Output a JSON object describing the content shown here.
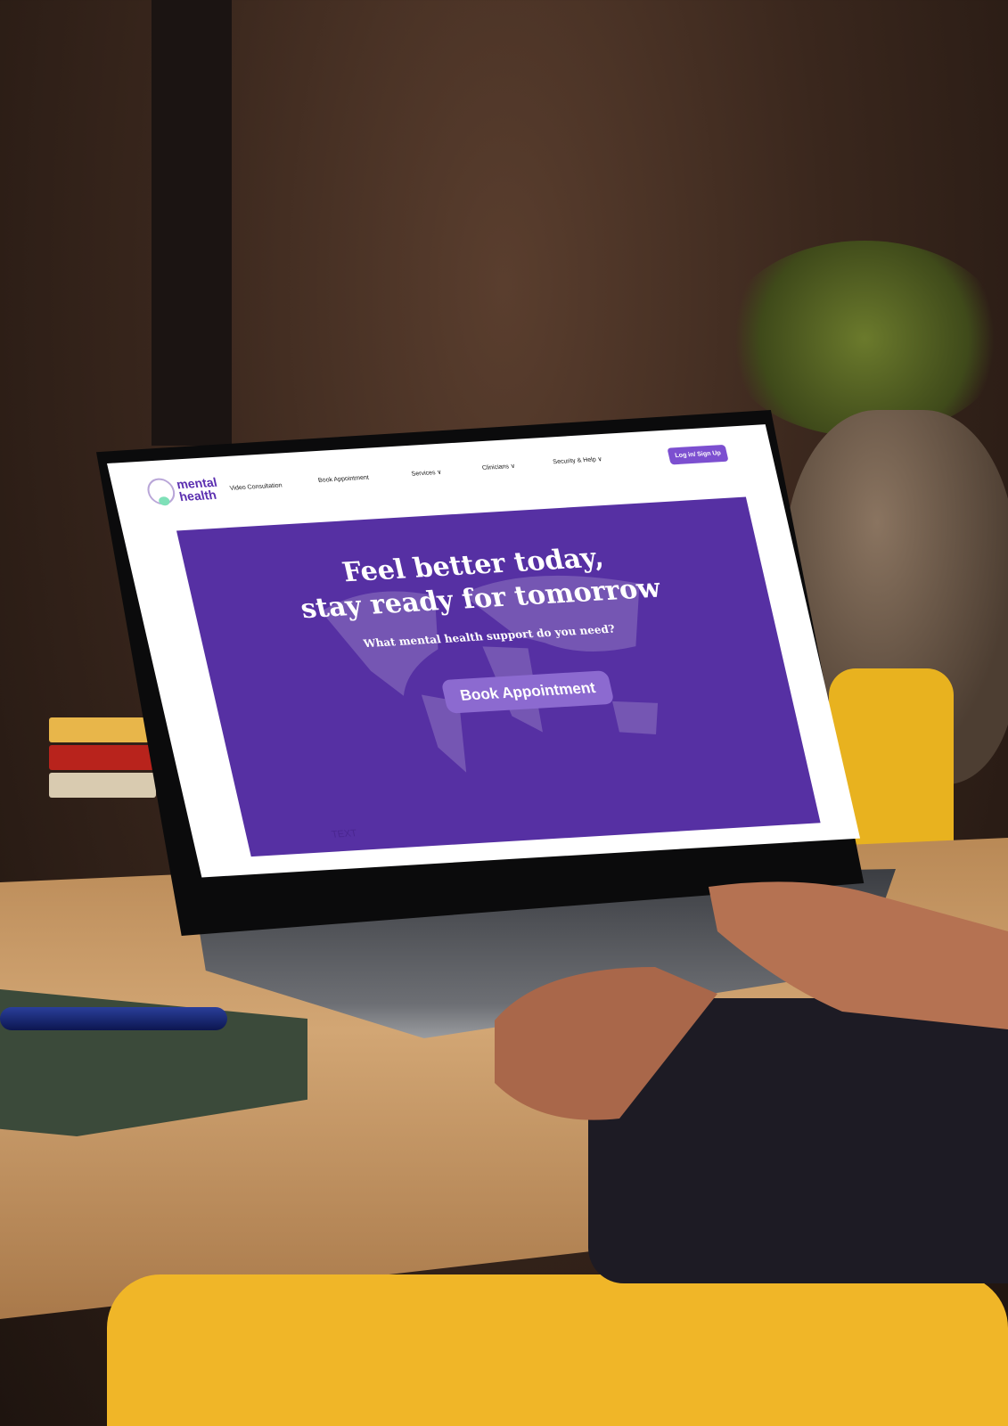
{
  "site": {
    "logo": {
      "line1": "mental",
      "line2": "health"
    },
    "nav": [
      {
        "label": "Video Consultation"
      },
      {
        "label": "Book Appointment"
      },
      {
        "label": "Services",
        "dropdown": "chevron-down-icon"
      },
      {
        "label": "Clinicians",
        "dropdown": "chevron-down-icon"
      },
      {
        "label": "Security & Help",
        "dropdown": "chevron-down-icon"
      }
    ],
    "auth_button": "Log in/ Sign Up",
    "hero": {
      "title_line1": "Feel better today,",
      "title_line2": "stay ready for tomorrow",
      "subtitle": "What mental health support do you need?",
      "cta": "Book Appointment",
      "placeholder_tag": "TEXT"
    },
    "colors": {
      "brand": "#5630a3",
      "accent": "#8c6ad0",
      "button": "#7c4fd0"
    }
  }
}
